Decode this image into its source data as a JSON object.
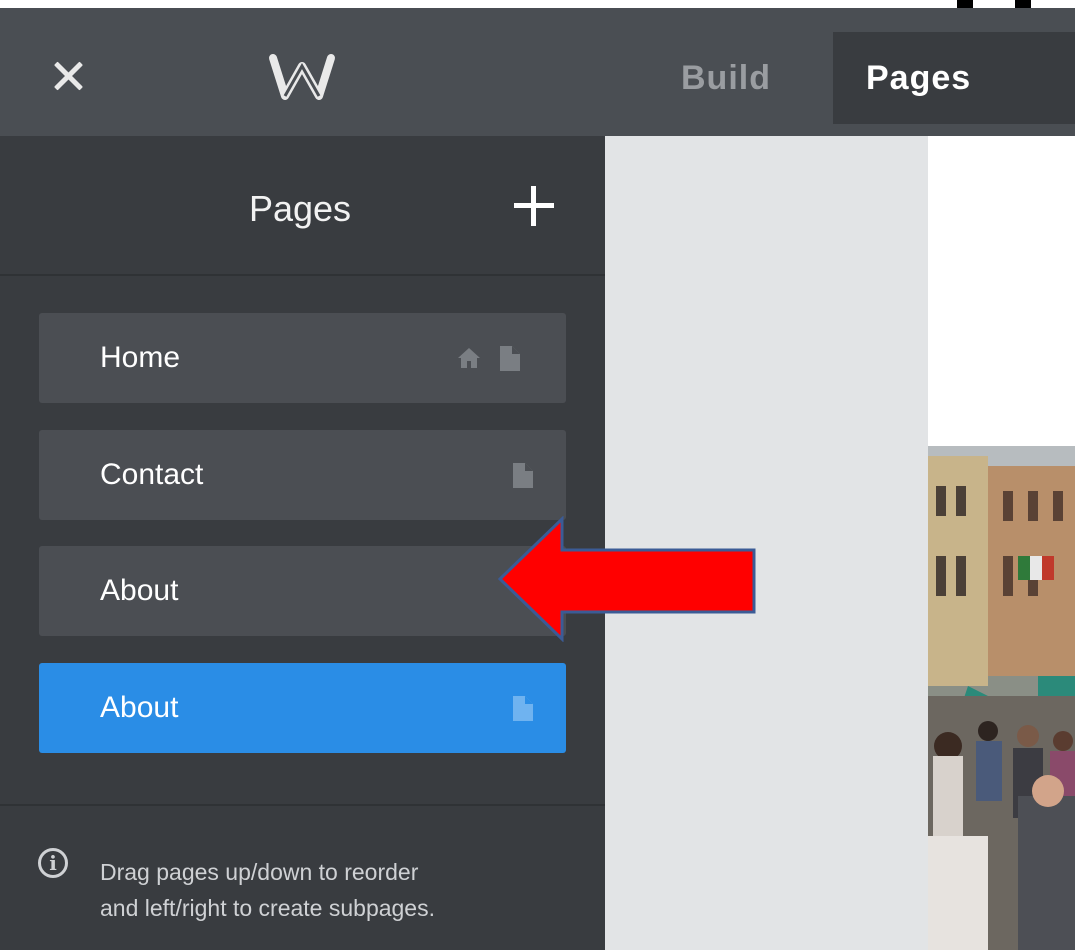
{
  "topbar": {
    "tabs": [
      {
        "label": "Build",
        "active": false
      },
      {
        "label": "Pages",
        "active": true
      }
    ]
  },
  "sidebar": {
    "title": "Pages",
    "pages": [
      {
        "label": "Home",
        "is_home": true
      },
      {
        "label": "Contact",
        "is_home": false
      },
      {
        "label": "About",
        "is_home": false
      },
      {
        "label": "About",
        "is_home": false,
        "selected": true
      }
    ],
    "info_lines": [
      "Drag pages up/down to reorder",
      "and left/right to create subpages."
    ],
    "info_icon_glyph": "i"
  },
  "colors": {
    "topbar": "#4a4e53",
    "sidebar": "#393c40",
    "page_item": "#4b4e53",
    "selected_item": "#2a8de6",
    "annotation_arrow": "#ff0000"
  }
}
